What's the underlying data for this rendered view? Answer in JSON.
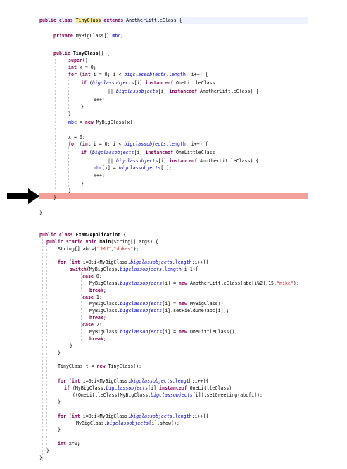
{
  "snippet1": [
    [
      [
        "kw",
        "public"
      ],
      [
        "t",
        " "
      ],
      [
        "kw",
        "class"
      ],
      [
        "t",
        " "
      ],
      [
        "cls",
        "TinyClass"
      ],
      [
        "t",
        " "
      ],
      [
        "kw",
        "extends"
      ],
      [
        "t",
        " AnotherLittleClass {"
      ]
    ],
    [
      [
        "t",
        ""
      ]
    ],
    [
      [
        "kw",
        "private"
      ],
      [
        "t",
        " MyBigClass[] "
      ],
      [
        "pf",
        "mbc"
      ],
      [
        "t",
        ";"
      ]
    ],
    [
      [
        "t",
        ""
      ]
    ],
    [
      [
        "kw",
        "public"
      ],
      [
        "t",
        " "
      ],
      [
        "b",
        "TinyClass"
      ],
      [
        "t",
        "() {"
      ]
    ],
    [
      [
        "kw",
        "super"
      ],
      [
        "t",
        "();"
      ]
    ],
    [
      [
        "kw",
        "int"
      ],
      [
        "t",
        " x = 0;"
      ]
    ],
    [
      [
        "kw",
        "for"
      ],
      [
        "t",
        " ("
      ],
      [
        "kw",
        "int"
      ],
      [
        "t",
        " i = 0; i < "
      ],
      [
        "fd",
        "bigclassobjects"
      ],
      [
        "t",
        "."
      ],
      [
        "pf",
        "length"
      ],
      [
        "t",
        "; i++) {"
      ]
    ],
    [
      [
        "kw",
        "if"
      ],
      [
        "t",
        " ("
      ],
      [
        "fd",
        "bigclassobjects"
      ],
      [
        "t",
        "[i] "
      ],
      [
        "kw",
        "instanceof"
      ],
      [
        "t",
        " OneLittleClass"
      ]
    ],
    [
      [
        "t",
        "|| "
      ],
      [
        "fd",
        "bigclassobjects"
      ],
      [
        "t",
        "[i] "
      ],
      [
        "kw",
        "instanceof"
      ],
      [
        "t",
        " AnotherLittleClass) {"
      ]
    ],
    [
      [
        "t",
        "x++;"
      ]
    ],
    [
      [
        "t",
        "}"
      ]
    ],
    [
      [
        "t",
        "}"
      ]
    ],
    [
      [
        "pf",
        "mbc"
      ],
      [
        "t",
        " = "
      ],
      [
        "kw",
        "new"
      ],
      [
        "t",
        " MyBigClass[x];"
      ]
    ],
    [
      [
        "t",
        ""
      ]
    ],
    [
      [
        "t",
        "x = 0;"
      ]
    ],
    [
      [
        "kw",
        "for"
      ],
      [
        "t",
        " ("
      ],
      [
        "kw",
        "int"
      ],
      [
        "t",
        " i = 0; i < "
      ],
      [
        "fd",
        "bigclassobjects"
      ],
      [
        "t",
        "."
      ],
      [
        "pf",
        "length"
      ],
      [
        "t",
        "; i++) {"
      ]
    ],
    [
      [
        "kw",
        "if"
      ],
      [
        "t",
        " ("
      ],
      [
        "fd",
        "bigclassobjects"
      ],
      [
        "t",
        "[i] "
      ],
      [
        "kw",
        "instanceof"
      ],
      [
        "t",
        " OneLittleClass"
      ]
    ],
    [
      [
        "t",
        "|| "
      ],
      [
        "fd",
        "bigclassobjects"
      ],
      [
        "t",
        "[i] "
      ],
      [
        "kw",
        "instanceof"
      ],
      [
        "t",
        " AnotherLittleClass) {"
      ]
    ],
    [
      [
        "pf",
        "mbc"
      ],
      [
        "t",
        "[x] = "
      ],
      [
        "fd",
        "bigclassobjects"
      ],
      [
        "t",
        "[i];"
      ]
    ],
    [
      [
        "t",
        "x++;"
      ]
    ],
    [
      [
        "t",
        "}"
      ]
    ],
    [
      [
        "t",
        "}"
      ]
    ],
    [
      [
        "t",
        "}"
      ]
    ],
    [
      [
        "t",
        ""
      ]
    ],
    [
      [
        "t",
        "}"
      ]
    ]
  ],
  "snippet2": [
    [
      [
        "kw",
        "public"
      ],
      [
        "t",
        " "
      ],
      [
        "kw",
        "class"
      ],
      [
        "t",
        " "
      ],
      [
        "b",
        "Exam2Application"
      ],
      [
        "t",
        " {"
      ]
    ],
    [
      [
        "kw",
        "public"
      ],
      [
        "t",
        " "
      ],
      [
        "kw",
        "static"
      ],
      [
        "t",
        " "
      ],
      [
        "kw",
        "void"
      ],
      [
        "t",
        " "
      ],
      [
        "b",
        "main"
      ],
      [
        "t",
        "(String[] args) {"
      ]
    ],
    [
      [
        "t",
        "String[] abc={"
      ],
      [
        "str",
        "\"JMU\""
      ],
      [
        "t",
        ","
      ],
      [
        "str",
        "\"dukes\""
      ],
      [
        "t",
        "};"
      ]
    ],
    [
      [
        "t",
        ""
      ]
    ],
    [
      [
        "kw",
        "for"
      ],
      [
        "t",
        " ("
      ],
      [
        "kw",
        "int"
      ],
      [
        "t",
        " i=0;i<MyBigClass."
      ],
      [
        "fd",
        "bigclassobjects"
      ],
      [
        "t",
        "."
      ],
      [
        "pf",
        "length"
      ],
      [
        "t",
        ";i++){"
      ]
    ],
    [
      [
        "kw",
        "switch"
      ],
      [
        "t",
        "(MyBigClass."
      ],
      [
        "fd",
        "bigclassobjects"
      ],
      [
        "t",
        "."
      ],
      [
        "pf",
        "length"
      ],
      [
        "t",
        "-i-1){"
      ]
    ],
    [
      [
        "kw",
        "case"
      ],
      [
        "t",
        " 0:"
      ]
    ],
    [
      [
        "t",
        "MyBigClass."
      ],
      [
        "fd",
        "bigclassobjects"
      ],
      [
        "t",
        "[i] = "
      ],
      [
        "kw",
        "new"
      ],
      [
        "t",
        " AnotherLittleClass(abc[i%2],15,"
      ],
      [
        "str",
        "\"mike\""
      ],
      [
        "t",
        ");"
      ]
    ],
    [
      [
        "kw",
        "break"
      ],
      [
        "t",
        ";"
      ]
    ],
    [
      [
        "kw",
        "case"
      ],
      [
        "t",
        " 1:"
      ]
    ],
    [
      [
        "t",
        "MyBigClass."
      ],
      [
        "fd",
        "bigclassobjects"
      ],
      [
        "t",
        "[i] = "
      ],
      [
        "kw",
        "new"
      ],
      [
        "t",
        " MyBigClass();"
      ]
    ],
    [
      [
        "t",
        "MyBigClass."
      ],
      [
        "fd",
        "bigclassobjects"
      ],
      [
        "t",
        "[i].setFieldOne(abc[i]);"
      ]
    ],
    [
      [
        "kw",
        "break"
      ],
      [
        "t",
        ";"
      ]
    ],
    [
      [
        "kw",
        "case"
      ],
      [
        "t",
        " 2:"
      ]
    ],
    [
      [
        "t",
        "MyBigClass."
      ],
      [
        "fd",
        "bigclassobjects"
      ],
      [
        "t",
        "[i] = "
      ],
      [
        "kw",
        "new"
      ],
      [
        "t",
        " OneLittleClass();"
      ]
    ],
    [
      [
        "kw",
        "break"
      ],
      [
        "t",
        ";"
      ]
    ],
    [
      [
        "t",
        "}"
      ]
    ],
    [
      [
        "t",
        "}"
      ]
    ],
    [
      [
        "t",
        ""
      ]
    ],
    [
      [
        "t",
        "TinyClass t = "
      ],
      [
        "kw",
        "new"
      ],
      [
        "t",
        " TinyClass();"
      ]
    ],
    [
      [
        "t",
        ""
      ]
    ],
    [
      [
        "kw",
        "for"
      ],
      [
        "t",
        " ("
      ],
      [
        "kw",
        "int"
      ],
      [
        "t",
        " i=0;i<MyBigClass."
      ],
      [
        "fd",
        "bigclassobjects"
      ],
      [
        "t",
        "."
      ],
      [
        "pf",
        "length"
      ],
      [
        "t",
        ";i++){"
      ]
    ],
    [
      [
        "kw",
        "if"
      ],
      [
        "t",
        " (MyBigClass."
      ],
      [
        "fd",
        "bigclassobjects"
      ],
      [
        "t",
        "[i] "
      ],
      [
        "kw",
        "instanceof"
      ],
      [
        "t",
        " OneLittleClass)"
      ]
    ],
    [
      [
        "t",
        "((OneLittleClass)MyBigClass."
      ],
      [
        "fd",
        "bigclassobjects"
      ],
      [
        "t",
        "[i]).setGreeting(abc[i]);"
      ]
    ],
    [
      [
        "t",
        "}"
      ]
    ],
    [
      [
        "t",
        ""
      ]
    ],
    [
      [
        "kw",
        "for"
      ],
      [
        "t",
        " ("
      ],
      [
        "kw",
        "int"
      ],
      [
        "t",
        " i=0;i<MyBigClass."
      ],
      [
        "fd",
        "bigclassobjects"
      ],
      [
        "t",
        "."
      ],
      [
        "pf",
        "length"
      ],
      [
        "t",
        ";i++){"
      ]
    ],
    [
      [
        "t",
        "MyBigClass."
      ],
      [
        "fd",
        "bigclassobjects"
      ],
      [
        "t",
        "[i].show();"
      ]
    ],
    [
      [
        "t",
        "}"
      ]
    ],
    [
      [
        "t",
        ""
      ]
    ],
    [
      [
        "kw",
        "int"
      ],
      [
        "t",
        " x=0;"
      ]
    ],
    [
      [
        "t",
        "}"
      ]
    ],
    [
      [
        "t",
        "}"
      ]
    ]
  ],
  "highlight": {
    "color": "#f4a09a",
    "current_line": 23
  },
  "colors": {
    "keyword": "#7f0055",
    "field": "#0000c0",
    "string": "#d23a3a",
    "class_highlight": "#f4e79a"
  },
  "arrow_icon": "right-arrow-icon"
}
